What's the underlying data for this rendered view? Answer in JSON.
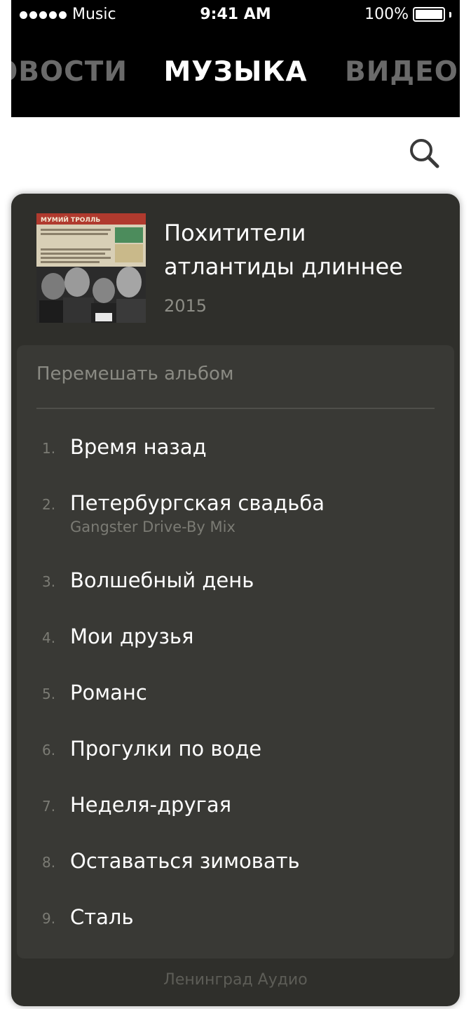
{
  "status_bar": {
    "carrier": "Music",
    "time": "9:41 AM",
    "battery": "100%"
  },
  "tabs": {
    "news": "ОВОСТИ",
    "music": "МУЗЫКА",
    "video": "ВИДЕО"
  },
  "search": {
    "icon": "search-icon"
  },
  "album": {
    "title_line1": "Похитители",
    "title_line2": "атлантиды длиннее",
    "year": "2015",
    "cover_text_band": "МУМИЙ ТРОЛЛЬ",
    "shuffle_label": "Перемешать альбом",
    "tracks": [
      {
        "number": "1.",
        "title": "Время назад",
        "subtitle": ""
      },
      {
        "number": "2.",
        "title": "Петербургская свадьба",
        "subtitle": "Gangster Drive-By Mix"
      },
      {
        "number": "3.",
        "title": "Волшебный день",
        "subtitle": ""
      },
      {
        "number": "4.",
        "title": "Мои друзья",
        "subtitle": ""
      },
      {
        "number": "5.",
        "title": "Романс",
        "subtitle": ""
      },
      {
        "number": "6.",
        "title": "Прогулки по воде",
        "subtitle": ""
      },
      {
        "number": "7.",
        "title": "Неделя-другая",
        "subtitle": ""
      },
      {
        "number": "8.",
        "title": "Оставаться зимовать",
        "subtitle": ""
      },
      {
        "number": "9.",
        "title": "Сталь",
        "subtitle": ""
      }
    ],
    "label": "Ленинград Аудио"
  },
  "colors": {
    "card": "#2f2f2b",
    "panel": "#393935",
    "header": "#000000"
  }
}
